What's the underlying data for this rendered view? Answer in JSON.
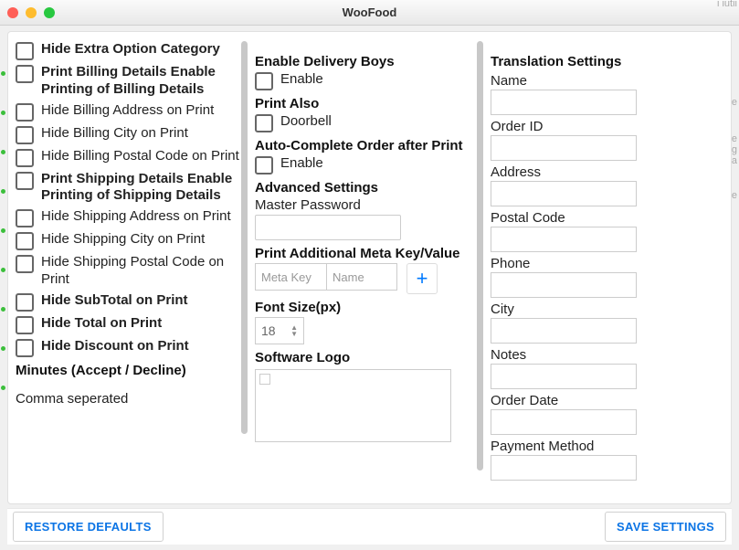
{
  "window": {
    "title": "WooFood"
  },
  "col1": {
    "items": [
      {
        "label": "Hide Extra Option Category",
        "bold": true
      },
      {
        "label": "Print Billing Details Enable Printing of Billing Details",
        "bold": true
      },
      {
        "label": "Hide Billing Address on Print",
        "bold": false
      },
      {
        "label": "Hide Billing City on Print",
        "bold": false
      },
      {
        "label": "Hide Billing Postal Code on Print",
        "bold": false
      },
      {
        "label": "Print Shipping Details Enable Printing of Shipping Details",
        "bold": true
      },
      {
        "label": "Hide Shipping Address on Print",
        "bold": false
      },
      {
        "label": "Hide Shipping City on Print",
        "bold": false
      },
      {
        "label": "Hide Shipping Postal Code on Print",
        "bold": false
      },
      {
        "label": "Hide SubTotal on Print",
        "bold": true
      },
      {
        "label": "Hide Total on Print",
        "bold": true
      },
      {
        "label": "Hide Discount on Print",
        "bold": true
      }
    ],
    "minutes_heading": "Minutes (Accept / Decline)",
    "minutes_note": "Comma seperated"
  },
  "col2": {
    "enable_delivery_heading": "Enable Delivery Boys",
    "enable_delivery_label": "Enable",
    "print_also_heading": "Print Also",
    "print_also_label": "Doorbell",
    "auto_complete_heading": "Auto-Complete Order after Print",
    "auto_complete_label": "Enable",
    "advanced_heading": "Advanced Settings",
    "master_password_label": "Master Password",
    "meta_heading": "Print Additional Meta Key/Value",
    "meta_key_placeholder": "Meta Key",
    "meta_name_placeholder": "Name",
    "font_size_heading": "Font Size(px)",
    "font_size_value": "18",
    "logo_heading": "Software Logo"
  },
  "col3": {
    "heading": "Translation Settings",
    "fields": [
      "Name",
      "Order ID",
      "Address",
      "Postal Code",
      "Phone",
      "City",
      "Notes",
      "Order Date",
      "Payment Method"
    ]
  },
  "footer": {
    "restore": "RESTORE DEFAULTS",
    "save": "SAVE SETTINGS"
  }
}
